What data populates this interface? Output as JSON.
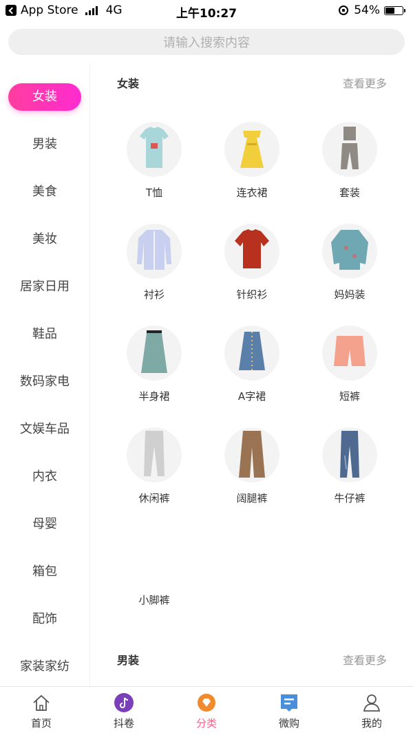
{
  "status_bar": {
    "back_app": "App Store",
    "network": "4G",
    "time": "上午10:27",
    "battery": "54%"
  },
  "search": {
    "placeholder": "请输入搜索内容"
  },
  "sidebar": {
    "active_index": 0,
    "items": [
      {
        "label": "女装"
      },
      {
        "label": "男装"
      },
      {
        "label": "美食"
      },
      {
        "label": "美妆"
      },
      {
        "label": "居家日用"
      },
      {
        "label": "鞋品"
      },
      {
        "label": "数码家电"
      },
      {
        "label": "文娱车品"
      },
      {
        "label": "内衣"
      },
      {
        "label": "母婴"
      },
      {
        "label": "箱包"
      },
      {
        "label": "配饰"
      },
      {
        "label": "家装家纺"
      }
    ]
  },
  "sections": [
    {
      "title": "女装",
      "more": "查看更多",
      "items": [
        {
          "label": "T恤",
          "icon": "tshirt-icon",
          "color": "#a9d6d8"
        },
        {
          "label": "连衣裙",
          "icon": "dress-icon",
          "color": "#f1cf3c"
        },
        {
          "label": "套装",
          "icon": "suit-set-icon",
          "color": "#8f8a83"
        },
        {
          "label": "衬衫",
          "icon": "shirt-icon",
          "color": "#c9cfee"
        },
        {
          "label": "针织衫",
          "icon": "knit-sweater-icon",
          "color": "#b8301e"
        },
        {
          "label": "妈妈装",
          "icon": "mom-top-icon",
          "color": "#6fa7b2"
        },
        {
          "label": "半身裙",
          "icon": "skirt-icon",
          "color": "#7ea9a4"
        },
        {
          "label": "A字裙",
          "icon": "a-line-skirt-icon",
          "color": "#5a7fa8"
        },
        {
          "label": "短裤",
          "icon": "shorts-icon",
          "color": "#f4a28d"
        },
        {
          "label": "休闲裤",
          "icon": "casual-pants-icon",
          "color": "#cfcfcf"
        },
        {
          "label": "阔腿裤",
          "icon": "wide-pants-icon",
          "color": "#9a7452"
        },
        {
          "label": "牛仔裤",
          "icon": "jeans-icon",
          "color": "#4e6a91"
        },
        {
          "label": "小脚裤",
          "icon": "skinny-pants-icon",
          "color": ""
        }
      ]
    },
    {
      "title": "男装",
      "more": "查看更多"
    }
  ],
  "tabbar": {
    "active_index": 2,
    "items": [
      {
        "label": "首页",
        "icon": "home-icon"
      },
      {
        "label": "抖卷",
        "icon": "douyin-icon",
        "color": "#7b3fb7"
      },
      {
        "label": "分类",
        "icon": "category-icon",
        "color": "#f08a2c"
      },
      {
        "label": "微购",
        "icon": "weigou-icon",
        "color": "#4a8fdc"
      },
      {
        "label": "我的",
        "icon": "profile-icon"
      }
    ]
  }
}
